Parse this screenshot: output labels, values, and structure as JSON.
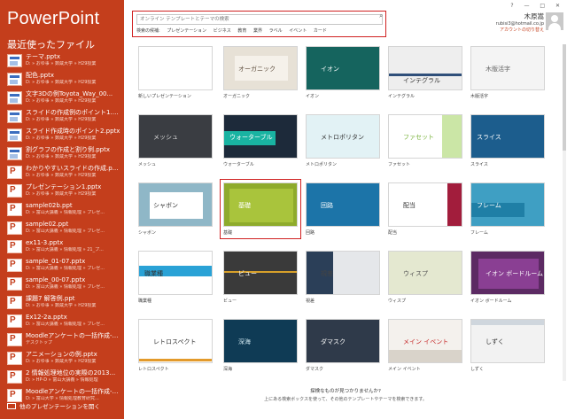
{
  "app": {
    "title": "PowerPoint"
  },
  "sidebar": {
    "heading": "最近使ったファイル",
    "files": [
      {
        "name": "テーマ.pptx",
        "path": "D: » おゆ事 » 数蔵大学 » H29授業",
        "icon": "thumbnail"
      },
      {
        "name": "配色.pptx",
        "path": "D: » おゆ事 » 数蔵大学 » H29授業",
        "icon": "thumbnail"
      },
      {
        "name": "文字3Dの例Toyota_Way_00...",
        "path": "D: » おゆ事 » 数蔵大学 » H29授業",
        "icon": "thumbnail"
      },
      {
        "name": "スライドの作成例のポイント1.pptx",
        "path": "D: » おゆ事 » 数蔵大学 » H29授業",
        "icon": "thumbnail"
      },
      {
        "name": "スライド作成時のポイント2.pptx",
        "path": "D: » おゆ事 » 数蔵大学 » H29授業",
        "icon": "thumbnail"
      },
      {
        "name": "割グラフの作成と割り例.pptx",
        "path": "D: » おゆ事 » 数蔵大学 » H29授業",
        "icon": "thumbnail"
      },
      {
        "name": "わかりやすいスライドの作成.pptx",
        "path": "D: » おゆ事 » 数蔵大学 » H29授業",
        "icon": "powerpoint"
      },
      {
        "name": "プレゼンテーション1.pptx",
        "path": "D: » おゆ事 » 数蔵大学 » H29授業",
        "icon": "powerpoint"
      },
      {
        "name": "sample02b.ppt",
        "path": "D: » 富山大講義 » 情報処理 » プレゼ...",
        "icon": "powerpoint"
      },
      {
        "name": "sample02.ppt",
        "path": "D: » 富山大講義 » 情報処理 » プレゼ...",
        "icon": "powerpoint"
      },
      {
        "name": "ex11-3.pptx",
        "path": "D: » 富山大講義 » 情報処理 » 21_プ...",
        "icon": "powerpoint"
      },
      {
        "name": "sample_01-07.pptx",
        "path": "D: » 富山大講義 » 情報処理 » プレゼ...",
        "icon": "powerpoint"
      },
      {
        "name": "sample_00-07.pptx",
        "path": "D: » 富山大講義 » 情報処理 » プレゼ...",
        "icon": "powerpoint"
      },
      {
        "name": "課題7 解答例.ppt",
        "path": "D: » おゆ事 » 数蔵大学 » H29授業",
        "icon": "powerpoint"
      },
      {
        "name": "Ex12-2a.pptx",
        "path": "D: » 富山大講義 » 情報処理 » プレゼ...",
        "icon": "powerpoint"
      },
      {
        "name": "Moodleアンケートの一括作成-N...",
        "path": "デスクトップ",
        "icon": "powerpoint"
      },
      {
        "name": "アニメーションの例.pptx",
        "path": "D: » おゆ事 » 数蔵大学 » H29授業",
        "icon": "powerpoint"
      },
      {
        "name": "2 情報処理地位の実際の2013...",
        "path": "D: » HP-D » 富山大講義 » 情報処理",
        "icon": "powerpoint"
      },
      {
        "name": "Moodleアンケートの一括作成-N...",
        "path": "D: » 富山大学 » 情報処理教育研究...",
        "icon": "powerpoint"
      }
    ],
    "open_other": "他のプレゼンテーションを開く"
  },
  "search": {
    "placeholder": "オンライン テンプレートとテーマの検索",
    "suggested_label": "検索の候補:",
    "suggestions": [
      "プレゼンテーション",
      "ビジネス",
      "教育",
      "業界",
      "ラベル",
      "イベント",
      "カード"
    ]
  },
  "window": {
    "help": "?",
    "minimize": "—",
    "restore": "□",
    "close": "✕"
  },
  "user": {
    "name": "木原嵩",
    "email": "rubisi3@hotmail.co.jp",
    "switch": "アカウントの切り替え"
  },
  "templates": [
    {
      "label": "新しいプレゼンテーション",
      "title": "",
      "bg": "#ffffff",
      "fg": "#333333",
      "accent": "#ffffff"
    },
    {
      "label": "オーガニック",
      "title": "オーガニック",
      "bg": "#e7e1d6",
      "fg": "#5b4a3a",
      "accent": "#f5f1ea"
    },
    {
      "label": "イオン",
      "title": "イオン",
      "bg": "#15645e",
      "fg": "#ffffff",
      "accent": "#c42c2c"
    },
    {
      "label": "インテグラル",
      "title": "インテグラル",
      "bg": "#eeeeee",
      "fg": "#333333",
      "accent": "#2f4f7a"
    },
    {
      "label": "木版活字",
      "title": "木版活字",
      "bg": "#f4f4f4",
      "fg": "#666666",
      "accent": "#dddddd"
    },
    {
      "label": "メッシュ",
      "title": "メッシュ",
      "bg": "#3a3d42",
      "fg": "#dddddd",
      "accent": "#52565c"
    },
    {
      "label": "ウォーターブル",
      "title": "ウォーターブル",
      "bg": "#1d2a3a",
      "fg": "#ffffff",
      "accent": "#19b3a2"
    },
    {
      "label": "メトロポリタン",
      "title": "メトロポリタン",
      "bg": "#ffffff",
      "fg": "#333333",
      "accent": "#3aa6b9"
    },
    {
      "label": "ファセット",
      "title": "ファセット",
      "bg": "#ffffff",
      "fg": "#7ab33d",
      "accent": "#a9d56b"
    },
    {
      "label": "スライス",
      "title": "スライス",
      "bg": "#1c5d8d",
      "fg": "#ffffff",
      "accent": "#2b84bf"
    },
    {
      "label": "シャボン",
      "title": "シャボン",
      "bg": "#8fb7c7",
      "fg": "#333333",
      "accent": "#ffffff"
    },
    {
      "label": "基礎",
      "title": "基礎",
      "bg": "#8eab2c",
      "fg": "#ffffff",
      "accent": "#a9c43c"
    },
    {
      "label": "回路",
      "title": "回路",
      "bg": "#1c74a8",
      "fg": "#ffffff",
      "accent": "#2a8dc6"
    },
    {
      "label": "配当",
      "title": "配当",
      "bg": "#ffffff",
      "fg": "#333333",
      "accent": "#a21d3c"
    },
    {
      "label": "フレーム",
      "title": "フレーム",
      "bg": "#3f9fc3",
      "fg": "#ffffff",
      "accent": "#2a7fa3"
    },
    {
      "label": "職業種",
      "title": "職業種",
      "bg": "#ffffff",
      "fg": "#333333",
      "accent": "#2aa2d6"
    },
    {
      "label": "ビュー",
      "title": "ビュー",
      "bg": "#3a3a3a",
      "fg": "#ffffff",
      "accent": "#d7a02a"
    },
    {
      "label": "視差",
      "title": "視差",
      "bg": "#e5e7ea",
      "fg": "#444444",
      "accent": "#2b3f58"
    },
    {
      "label": "ウィスプ",
      "title": "ウィスプ",
      "bg": "#e4e8d0",
      "fg": "#555555",
      "accent": "#c0c98e"
    },
    {
      "label": "イオン ボードルーム",
      "title": "イオン ボードルーム",
      "bg": "#5c2a63",
      "fg": "#ffffff",
      "accent": "#8a3f93"
    },
    {
      "label": "レトロスペクト",
      "title": "レトロスペクト",
      "bg": "#ffffff",
      "fg": "#333333",
      "accent": "#e39a2b"
    },
    {
      "label": "深海",
      "title": "深海",
      "bg": "#0f3b55",
      "fg": "#cde6ef",
      "accent": "#1a5d80"
    },
    {
      "label": "ダマスク",
      "title": "ダマスク",
      "bg": "#2f3a4a",
      "fg": "#ffffff",
      "accent": "#4a5a70"
    },
    {
      "label": "メイン イベント",
      "title": "メイン イベント",
      "bg": "#f4f1ed",
      "fg": "#c62828",
      "accent": "#d9d3ca"
    },
    {
      "label": "しずく",
      "title": "しずく",
      "bg": "#f2f2f2",
      "fg": "#333333",
      "accent": "#cfd6dd"
    }
  ],
  "footer": {
    "question": "探検なものが見つかりませんか?",
    "hint": "上にある検索ボックスを使って、その他のテンプレートやテーマを検索できます。"
  },
  "colors": {
    "sidebar": "#c43e1c",
    "highlight": "#d02020"
  }
}
